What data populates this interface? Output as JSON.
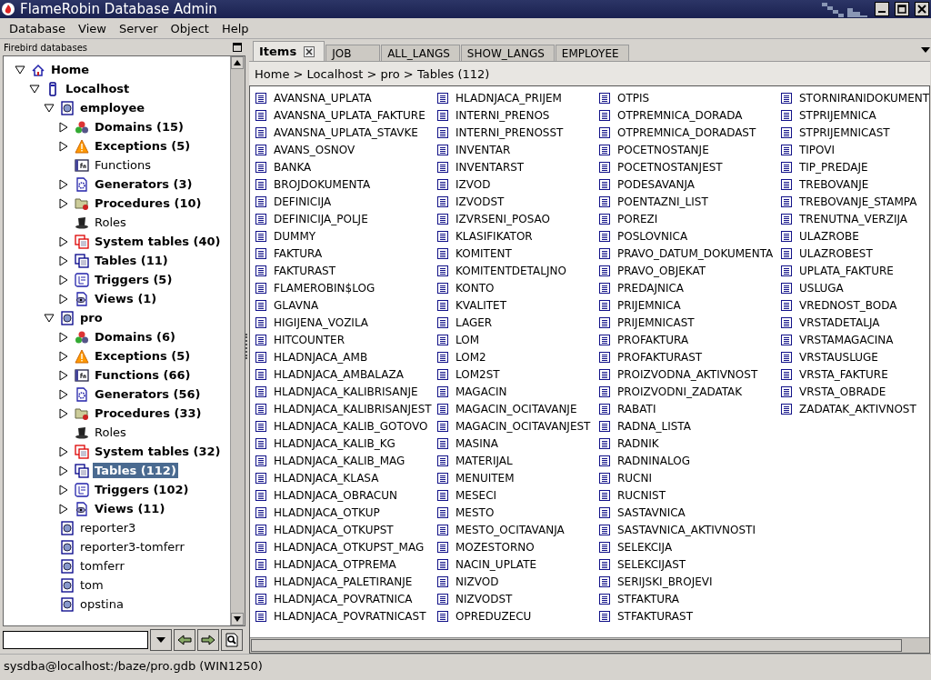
{
  "window": {
    "title": "FlameRobin Database Admin"
  },
  "menu": [
    "Database",
    "View",
    "Server",
    "Object",
    "Help"
  ],
  "sidebar": {
    "title": "Firebird databases",
    "tree": [
      {
        "label": "Home",
        "kind": "home",
        "bold": true,
        "expanded": true,
        "selected": false,
        "children": [
          {
            "label": "Localhost",
            "kind": "server",
            "bold": true,
            "expanded": true,
            "selected": false,
            "children": [
              {
                "label": "employee",
                "kind": "database",
                "bold": true,
                "expanded": true,
                "selected": false,
                "children": [
                  {
                    "label": "Domains (15)",
                    "kind": "domains",
                    "bold": true,
                    "expanded": false,
                    "selected": false
                  },
                  {
                    "label": "Exceptions (5)",
                    "kind": "exceptions",
                    "bold": true,
                    "expanded": false,
                    "selected": false
                  },
                  {
                    "label": "Functions",
                    "kind": "functions",
                    "bold": false,
                    "selected": false
                  },
                  {
                    "label": "Generators (3)",
                    "kind": "generators",
                    "bold": true,
                    "expanded": false,
                    "selected": false
                  },
                  {
                    "label": "Procedures (10)",
                    "kind": "procedures",
                    "bold": true,
                    "expanded": false,
                    "selected": false
                  },
                  {
                    "label": "Roles",
                    "kind": "roles",
                    "bold": false,
                    "selected": false
                  },
                  {
                    "label": "System tables (40)",
                    "kind": "systables",
                    "bold": true,
                    "expanded": false,
                    "selected": false
                  },
                  {
                    "label": "Tables (11)",
                    "kind": "tables",
                    "bold": true,
                    "expanded": false,
                    "selected": false
                  },
                  {
                    "label": "Triggers (5)",
                    "kind": "triggers",
                    "bold": true,
                    "expanded": false,
                    "selected": false
                  },
                  {
                    "label": "Views (1)",
                    "kind": "views",
                    "bold": true,
                    "expanded": false,
                    "selected": false
                  }
                ]
              },
              {
                "label": "pro",
                "kind": "database",
                "bold": true,
                "expanded": true,
                "selected": false,
                "children": [
                  {
                    "label": "Domains (6)",
                    "kind": "domains",
                    "bold": true,
                    "expanded": false,
                    "selected": false
                  },
                  {
                    "label": "Exceptions (5)",
                    "kind": "exceptions",
                    "bold": true,
                    "expanded": false,
                    "selected": false
                  },
                  {
                    "label": "Functions (66)",
                    "kind": "functions",
                    "bold": true,
                    "expanded": false,
                    "selected": false
                  },
                  {
                    "label": "Generators (56)",
                    "kind": "generators",
                    "bold": true,
                    "expanded": false,
                    "selected": false
                  },
                  {
                    "label": "Procedures (33)",
                    "kind": "procedures",
                    "bold": true,
                    "expanded": false,
                    "selected": false
                  },
                  {
                    "label": "Roles",
                    "kind": "roles",
                    "bold": false,
                    "selected": false
                  },
                  {
                    "label": "System tables (32)",
                    "kind": "systables",
                    "bold": true,
                    "expanded": false,
                    "selected": false
                  },
                  {
                    "label": "Tables (112)",
                    "kind": "tables",
                    "bold": true,
                    "expanded": false,
                    "selected": true
                  },
                  {
                    "label": "Triggers (102)",
                    "kind": "triggers",
                    "bold": true,
                    "expanded": false,
                    "selected": false
                  },
                  {
                    "label": "Views (11)",
                    "kind": "views",
                    "bold": true,
                    "expanded": false,
                    "selected": false
                  }
                ]
              },
              {
                "label": "reporter3",
                "kind": "database",
                "bold": false,
                "selected": false
              },
              {
                "label": "reporter3-tomferr",
                "kind": "database",
                "bold": false,
                "selected": false
              },
              {
                "label": "tomferr",
                "kind": "database",
                "bold": false,
                "selected": false
              },
              {
                "label": "tom",
                "kind": "database",
                "bold": false,
                "selected": false
              },
              {
                "label": "opstina",
                "kind": "database",
                "bold": false,
                "selected": false
              }
            ]
          }
        ]
      }
    ]
  },
  "tabs": [
    {
      "label": "Items",
      "selected": true,
      "closable": true
    },
    {
      "label": "JOB",
      "selected": false,
      "closable": false
    },
    {
      "label": "ALL_LANGS",
      "selected": false,
      "closable": false
    },
    {
      "label": "SHOW_LANGS",
      "selected": false,
      "closable": false
    },
    {
      "label": "EMPLOYEE",
      "selected": false,
      "closable": false
    }
  ],
  "breadcrumb": "Home > Localhost > pro > Tables (112)",
  "tables": [
    "AVANSNA_UPLATA",
    "AVANSNA_UPLATA_FAKTURE",
    "AVANSNA_UPLATA_STAVKE",
    "AVANS_OSNOV",
    "BANKA",
    "BROJDOKUMENTA",
    "DEFINICIJA",
    "DEFINICIJA_POLJE",
    "DUMMY",
    "FAKTURA",
    "FAKTURAST",
    "FLAMEROBIN$LOG",
    "GLAVNA",
    "HIGIJENA_VOZILA",
    "HITCOUNTER",
    "HLADNJACA_AMB",
    "HLADNJACA_AMBALAZA",
    "HLADNJACA_KALIBRISANJE",
    "HLADNJACA_KALIBRISANJEST",
    "HLADNJACA_KALIB_GOTOVO",
    "HLADNJACA_KALIB_KG",
    "HLADNJACA_KALIB_MAG",
    "HLADNJACA_KLASA",
    "HLADNJACA_OBRACUN",
    "HLADNJACA_OTKUP",
    "HLADNJACA_OTKUPST",
    "HLADNJACA_OTKUPST_MAG",
    "HLADNJACA_OTPREMA",
    "HLADNJACA_PALETIRANJE",
    "HLADNJACA_POVRATNICA",
    "HLADNJACA_POVRATNICAST",
    "HLADNJACA_PRIJEM",
    "INTERNI_PRENOS",
    "INTERNI_PRENOSST",
    "INVENTAR",
    "INVENTARST",
    "IZVOD",
    "IZVODST",
    "IZVRSENI_POSAO",
    "KLASIFIKATOR",
    "KOMITENT",
    "KOMITENTDETALJNO",
    "KONTO",
    "KVALITET",
    "LAGER",
    "LOM",
    "LOM2",
    "LOM2ST",
    "MAGACIN",
    "MAGACIN_OCITAVANJE",
    "MAGACIN_OCITAVANJEST",
    "MASINA",
    "MATERIJAL",
    "MENUITEM",
    "MESECI",
    "MESTO",
    "MESTO_OCITAVANJA",
    "MOZESTORNO",
    "NACIN_UPLATE",
    "NIZVOD",
    "NIZVODST",
    "OPREDUZECU",
    "OTPIS",
    "OTPREMNICA_DORADA",
    "OTPREMNICA_DORADAST",
    "POCETNOSTANJE",
    "POCETNOSTANJEST",
    "PODESAVANJA",
    "POENTAZNI_LIST",
    "POREZI",
    "POSLOVNICA",
    "PRAVO_DATUM_DOKUMENTA",
    "PRAVO_OBJEKAT",
    "PREDAJNICA",
    "PRIJEMNICA",
    "PRIJEMNICAST",
    "PROFAKTURA",
    "PROFAKTURAST",
    "PROIZVODNA_AKTIVNOST",
    "PROIZVODNI_ZADATAK",
    "RABATI",
    "RADNA_LISTA",
    "RADNIK",
    "RADNINALOG",
    "RUCNI",
    "RUCNIST",
    "SASTAVNICA",
    "SASTAVNICA_AKTIVNOSTI",
    "SELEKCIJA",
    "SELEKCIJAST",
    "SERIJSKI_BROJEVI",
    "STFAKTURA",
    "STFAKTURAST",
    "STORNIRANIDOKUMENT",
    "STPRIJEMNICA",
    "STPRIJEMNICAST",
    "TIPOVI",
    "TIP_PREDAJE",
    "TREBOVANJE",
    "TREBOVANJE_STAMPA",
    "TRENUTNA_VERZIJA",
    "ULAZROBE",
    "ULAZROBEST",
    "UPLATA_FAKTURE",
    "USLUGA",
    "VREDNOST_BODA",
    "VRSTADETALJA",
    "VRSTAMAGACINA",
    "VRSTAUSLUGE",
    "VRSTA_FAKTURE",
    "VRSTA_OBRADE",
    "ZADATAK_AKTIVNOST"
  ],
  "status_bar": "sysdba@localhost:/baze/pro.gdb (WIN1250)"
}
